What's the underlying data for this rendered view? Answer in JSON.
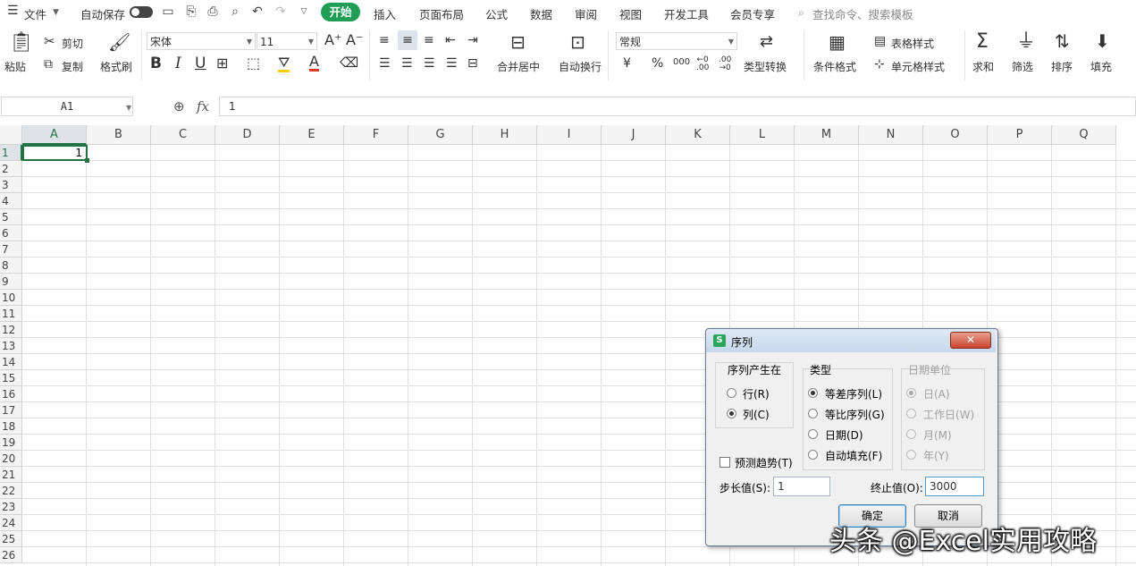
{
  "menubar": {
    "menu_label": "文件",
    "autosave": "自动保存",
    "tabs": [
      "开始",
      "插入",
      "页面布局",
      "公式",
      "数据",
      "审阅",
      "视图",
      "开发工具",
      "会员专享"
    ],
    "search_placeholder": "查找命令、搜索模板"
  },
  "ribbon": {
    "paste": "粘贴",
    "cut": "剪切",
    "copy": "复制",
    "format_painter": "格式刷",
    "font_name": "宋体",
    "font_size": "11",
    "merge_center": "合并居中",
    "wrap_text": "自动换行",
    "number_format": "常规",
    "type_convert": "类型转换",
    "conditional_format": "条件格式",
    "table_style": "表格样式",
    "cell_style": "单元格样式",
    "sum": "求和",
    "filter": "筛选",
    "sort": "排序",
    "fill": "填充",
    "bold": "B",
    "italic": "I",
    "underline": "U",
    "font_color_letter": "A"
  },
  "formula_bar": {
    "cell_ref": "A1",
    "fx": "fx",
    "value": "1"
  },
  "grid": {
    "columns": [
      "A",
      "B",
      "C",
      "D",
      "E",
      "F",
      "G",
      "H",
      "I",
      "J",
      "K",
      "L",
      "M",
      "N",
      "O",
      "P",
      "Q"
    ],
    "rows": [
      "1",
      "2",
      "3",
      "4",
      "5",
      "6",
      "7",
      "8",
      "9",
      "10",
      "11",
      "12",
      "13",
      "14",
      "15",
      "16",
      "17",
      "18",
      "19",
      "20",
      "21",
      "22",
      "23",
      "24",
      "25",
      "26"
    ],
    "a1_value": "1"
  },
  "dialog": {
    "title": "序列",
    "group_series_in": "序列产生在",
    "row": "行(R)",
    "column": "列(C)",
    "group_type": "类型",
    "linear": "等差序列(L)",
    "growth": "等比序列(G)",
    "date": "日期(D)",
    "autofill": "自动填充(F)",
    "group_date_unit": "日期单位",
    "day": "日(A)",
    "weekday": "工作日(W)",
    "month": "月(M)",
    "year": "年(Y)",
    "trend": "预测趋势(T)",
    "step_label": "步长值(S):",
    "step_value": "1",
    "stop_label": "终止值(O):",
    "stop_value": "3000",
    "ok": "确定",
    "cancel": "取消"
  },
  "watermark": "头条 @Excel实用攻略",
  "colors": {
    "accent_green": "#1f9d55",
    "selection_green": "#217346",
    "font_color_red": "#e03b24",
    "highlight_yellow": "#f5d000"
  }
}
